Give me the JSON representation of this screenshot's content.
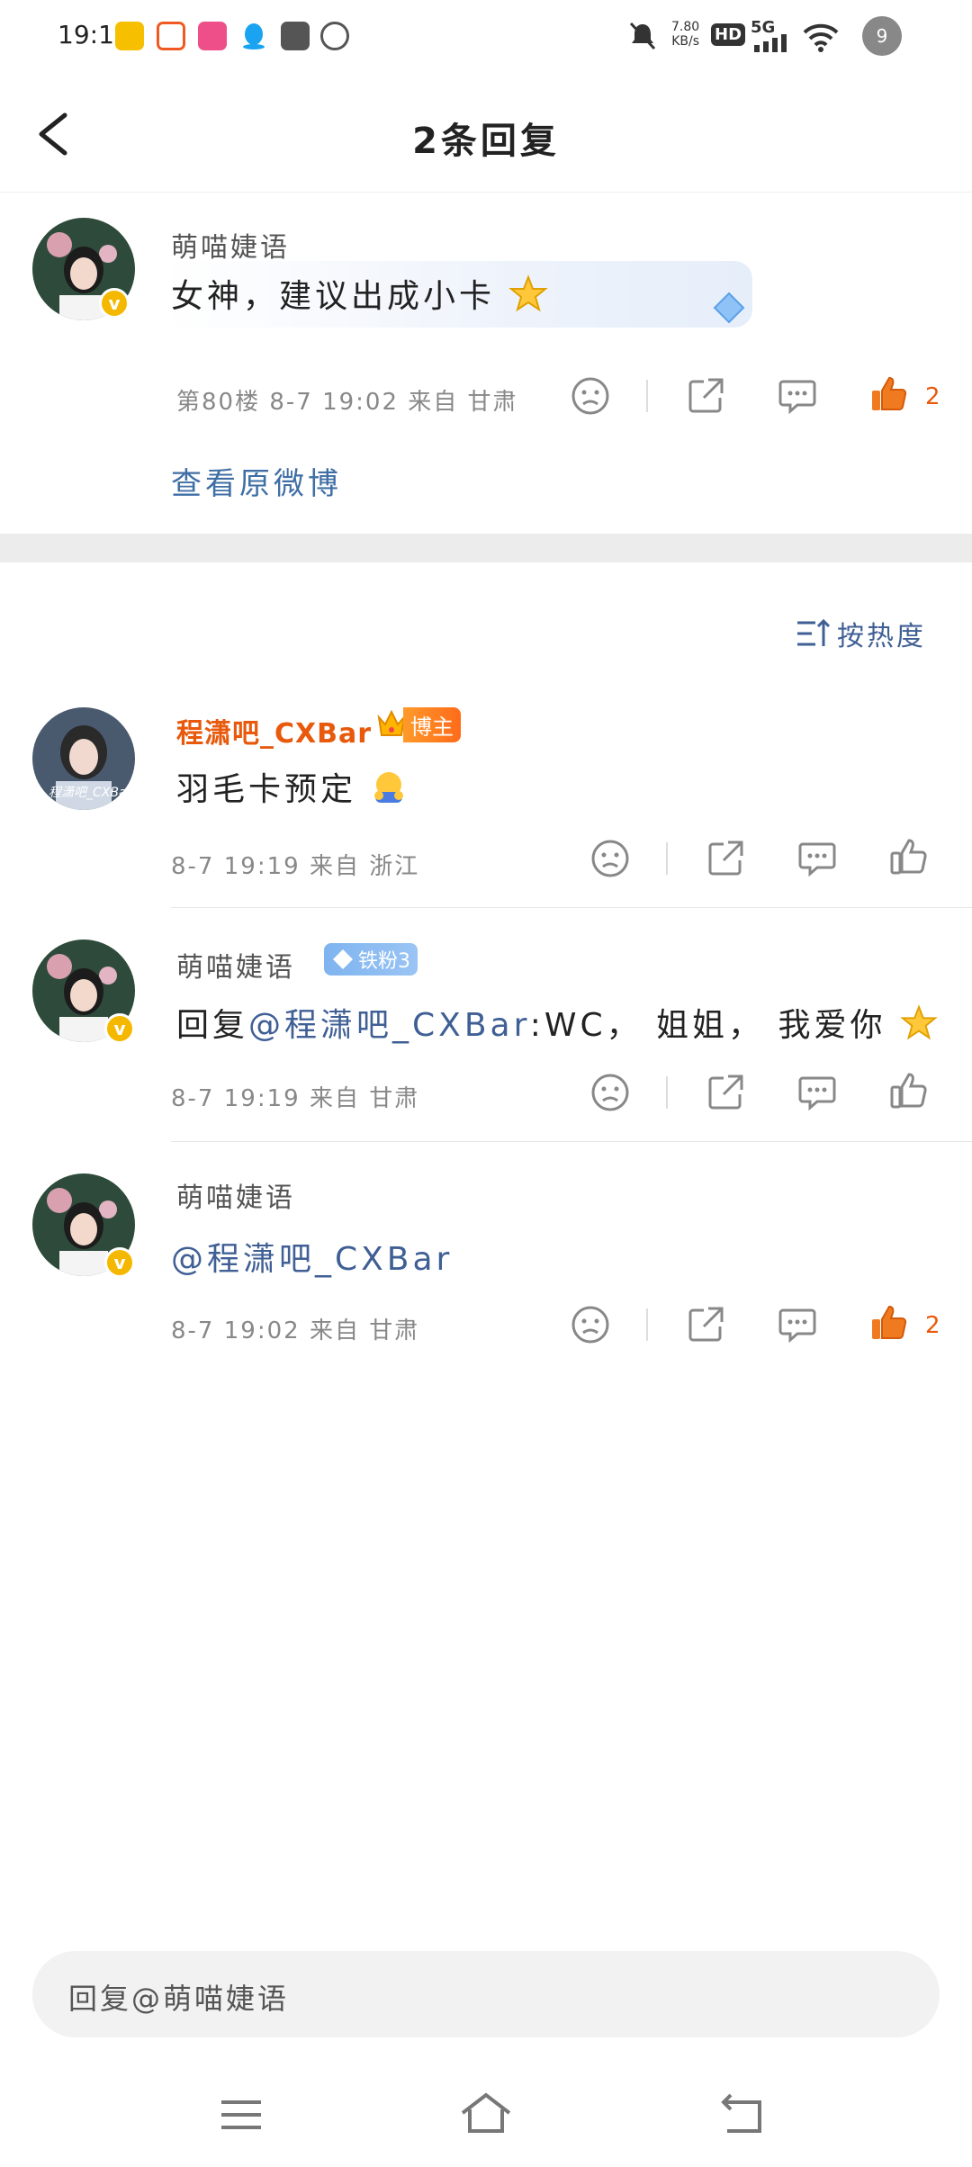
{
  "status_bar": {
    "time": "19:19",
    "net_speed_value": "7.80",
    "net_speed_unit": "KB/s",
    "hd_label": "HD",
    "signal_label": "5G",
    "battery": "9"
  },
  "header": {
    "title": "2条回复"
  },
  "original_comment": {
    "username": "萌喵婕语",
    "text": "女神，建议出成小卡",
    "floor": "第80楼",
    "time": "8-7  19:02",
    "location": "来自 甘肃",
    "like_count": "2",
    "view_original_label": "查看原微博"
  },
  "sort": {
    "label": "按热度"
  },
  "replies": [
    {
      "username": "程潇吧_CXBar",
      "badge": "博主",
      "text": "羽毛卡预定",
      "time": "8-7  19:19",
      "location": "来自 浙江",
      "avatar_caption": "程潇吧_CXBar"
    },
    {
      "username": "萌喵婕语",
      "badge": "铁粉3",
      "reply_prefix": "回复",
      "mention": "@程潇吧_CXBar",
      "text": ":WC，  姐姐，  我爱你",
      "time": "8-7  19:19",
      "location": "来自 甘肃"
    },
    {
      "username": "萌喵婕语",
      "mention": "@程潇吧_CXBar",
      "time": "8-7  19:02",
      "location": "来自 甘肃",
      "like_count": "2"
    }
  ],
  "input": {
    "placeholder": "回复@萌喵婕语"
  },
  "colors": {
    "accent_orange": "#e8590c",
    "link_blue": "#3f5f95",
    "vip_gold": "#f5b800"
  }
}
